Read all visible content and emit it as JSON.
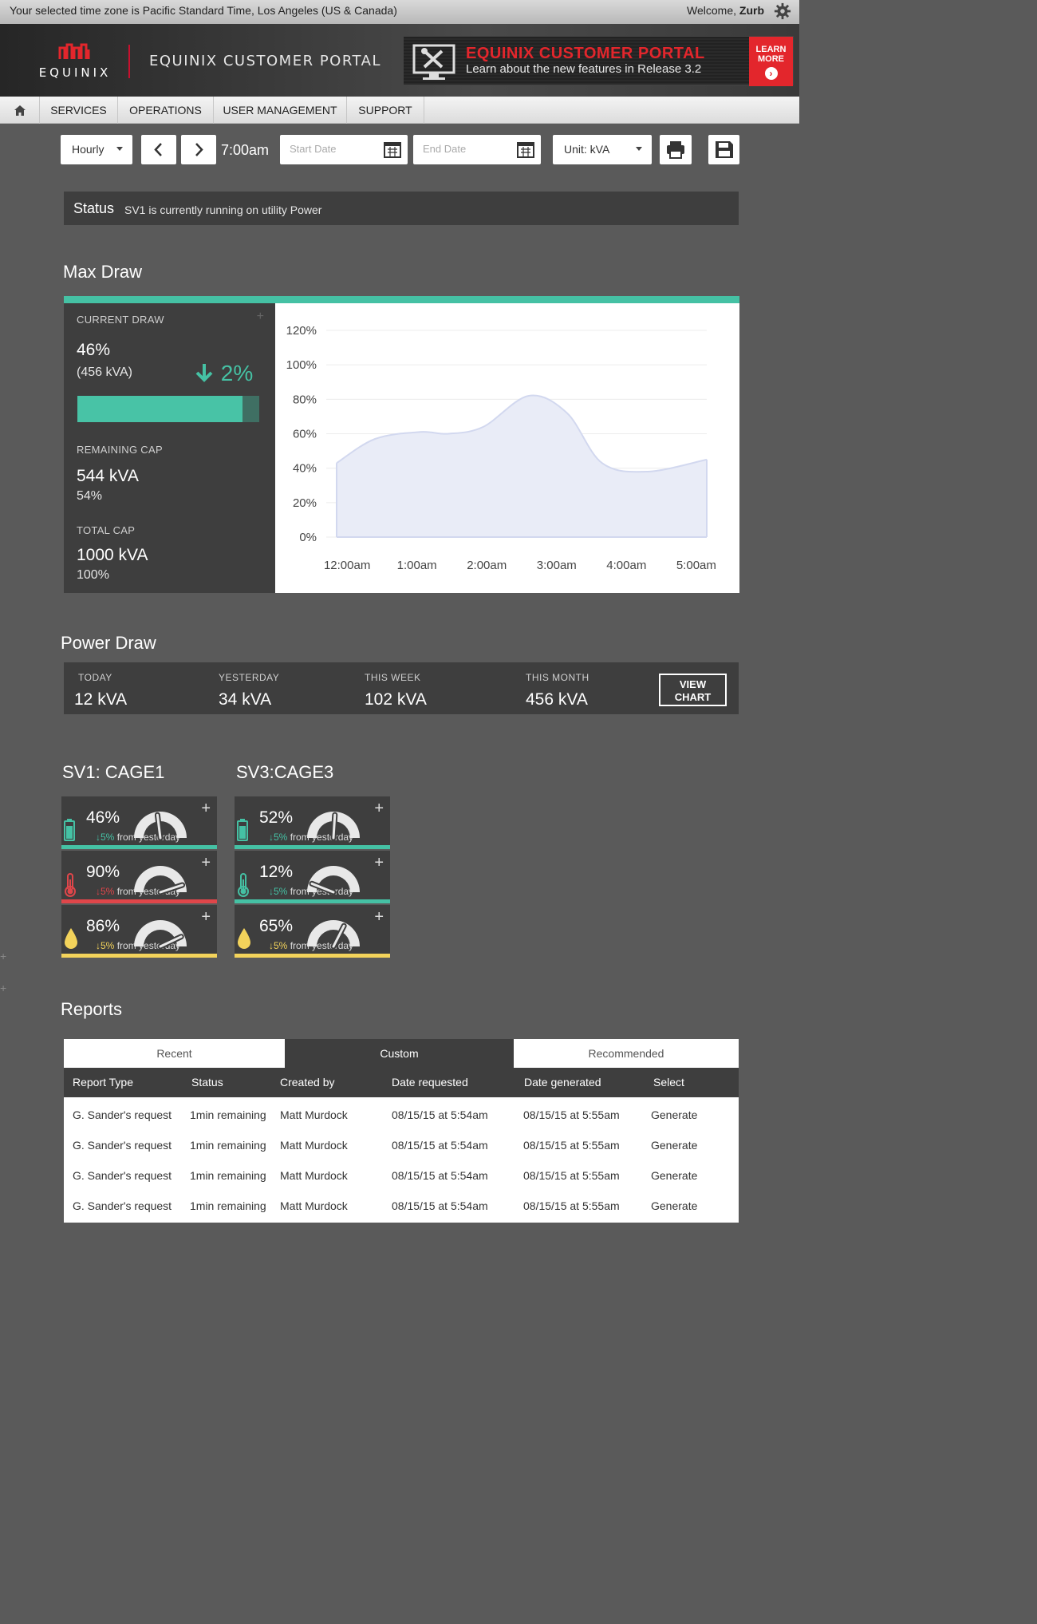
{
  "topbar": {
    "timezone_text": "Your selected time zone is Pacific Standard Time, Los Angeles (US & Canada)",
    "welcome_prefix": "Welcome,",
    "user_name": "Zurb",
    "gear_icon": "gear-icon"
  },
  "header": {
    "logo_text": "EQUINIX",
    "portal_title": "EQUINIX CUSTOMER PORTAL",
    "promo": {
      "title": "EQUINIX CUSTOMER PORTAL",
      "subtitle": "Learn about the new features in Release 3.2",
      "learn_line1": "LEARN",
      "learn_line2": "MORE",
      "icon": "tools-icon"
    },
    "colors": {
      "brand_red": "#e3262c",
      "accent_teal": "#45c1a4"
    }
  },
  "nav": {
    "home_icon": "home-icon",
    "items": [
      {
        "label": "SERVICES"
      },
      {
        "label": "OPERATIONS"
      },
      {
        "label": "USER MANAGEMENT"
      },
      {
        "label": "SUPPORT"
      }
    ]
  },
  "toolbar": {
    "interval": "Hourly",
    "time": "7:00am",
    "start_date_placeholder": "Start Date",
    "end_date_placeholder": "End Date",
    "unit": "Unit: kVA"
  },
  "status": {
    "label": "Status",
    "message": "SV1 is currently running on utility Power"
  },
  "max_draw": {
    "title": "Max Draw",
    "current_draw_label": "CURRENT DRAW",
    "current_pct": "46%",
    "current_kva": "(456 kVA)",
    "delta": "2%",
    "progress": 0.91,
    "remaining_label": "REMAINING CAP",
    "remaining_kva": "544 kVA",
    "remaining_pct": "54%",
    "total_label": "TOTAL CAP",
    "total_kva": "1000 kVA",
    "total_pct": "100%"
  },
  "chart_data": {
    "type": "area",
    "x": [
      "12:00am",
      "1:00am",
      "2:00am",
      "3:00am",
      "4:00am",
      "5:00am"
    ],
    "points": [
      {
        "t": 0.0,
        "y": 43
      },
      {
        "t": 0.55,
        "y": 57
      },
      {
        "t": 1.2,
        "y": 61
      },
      {
        "t": 1.6,
        "y": 60
      },
      {
        "t": 2.1,
        "y": 64
      },
      {
        "t": 2.75,
        "y": 82
      },
      {
        "t": 3.3,
        "y": 72
      },
      {
        "t": 3.8,
        "y": 43
      },
      {
        "t": 4.45,
        "y": 38
      },
      {
        "t": 5.3,
        "y": 45
      }
    ],
    "y_ticks": [
      "0%",
      "20%",
      "40%",
      "60%",
      "80%",
      "100%",
      "120%"
    ],
    "ylim": [
      0,
      120
    ],
    "grid": true,
    "fill_color": "#e9ecf7",
    "line_color": "#d2d8ef"
  },
  "power_draw": {
    "title": "Power Draw",
    "cells": [
      {
        "label": "TODAY",
        "value": "12 kVA"
      },
      {
        "label": "YESTERDAY",
        "value": "34 kVA"
      },
      {
        "label": "THIS WEEK",
        "value": "102 kVA"
      },
      {
        "label": "THIS MONTH",
        "value": "456 kVA"
      }
    ],
    "view_chart_line1": "VIEW",
    "view_chart_line2": "CHART"
  },
  "cages": [
    {
      "title": "SV1: CAGE1",
      "tiles": [
        {
          "icon": "battery-icon",
          "pct": "46%",
          "level": 0.46,
          "delta": "5%",
          "suffix": "from yesterday",
          "color": "#45c1a4"
        },
        {
          "icon": "thermometer-icon",
          "pct": "90%",
          "level": 0.9,
          "delta": "5%",
          "suffix": "from yesterday",
          "color": "#e0464a"
        },
        {
          "icon": "droplet-icon",
          "pct": "86%",
          "level": 0.86,
          "delta": "5%",
          "suffix": "from yesterday",
          "color": "#f3d35b"
        }
      ]
    },
    {
      "title": "SV3:CAGE3",
      "tiles": [
        {
          "icon": "battery-icon",
          "pct": "52%",
          "level": 0.52,
          "delta": "5%",
          "suffix": "from yesterday",
          "color": "#45c1a4"
        },
        {
          "icon": "thermometer-icon",
          "pct": "12%",
          "level": 0.12,
          "delta": "5%",
          "suffix": "from yesterday",
          "color": "#45c1a4"
        },
        {
          "icon": "droplet-icon",
          "pct": "65%",
          "level": 0.65,
          "delta": "5%",
          "suffix": "from yesterday",
          "color": "#f3d35b"
        }
      ]
    }
  ],
  "reports": {
    "title": "Reports",
    "tabs": [
      "Recent",
      "Custom",
      "Recommended"
    ],
    "active_tab": "Custom",
    "columns": [
      "Report Type",
      "Status",
      "Created by",
      "Date requested",
      "Date generated",
      "Select"
    ],
    "rows": [
      [
        "G. Sander's request",
        "1min remaining",
        "Matt Murdock",
        "08/15/15 at 5:54am",
        "08/15/15 at 5:55am",
        "Generate"
      ],
      [
        "G. Sander's request",
        "1min remaining",
        "Matt Murdock",
        "08/15/15 at 5:54am",
        "08/15/15 at 5:55am",
        "Generate"
      ],
      [
        "G. Sander's request",
        "1min remaining",
        "Matt Murdock",
        "08/15/15 at 5:54am",
        "08/15/15 at 5:55am",
        "Generate"
      ],
      [
        "G. Sander's request",
        "1min remaining",
        "Matt Murdock",
        "08/15/15 at 5:54am",
        "08/15/15 at 5:55am",
        "Generate"
      ]
    ]
  }
}
